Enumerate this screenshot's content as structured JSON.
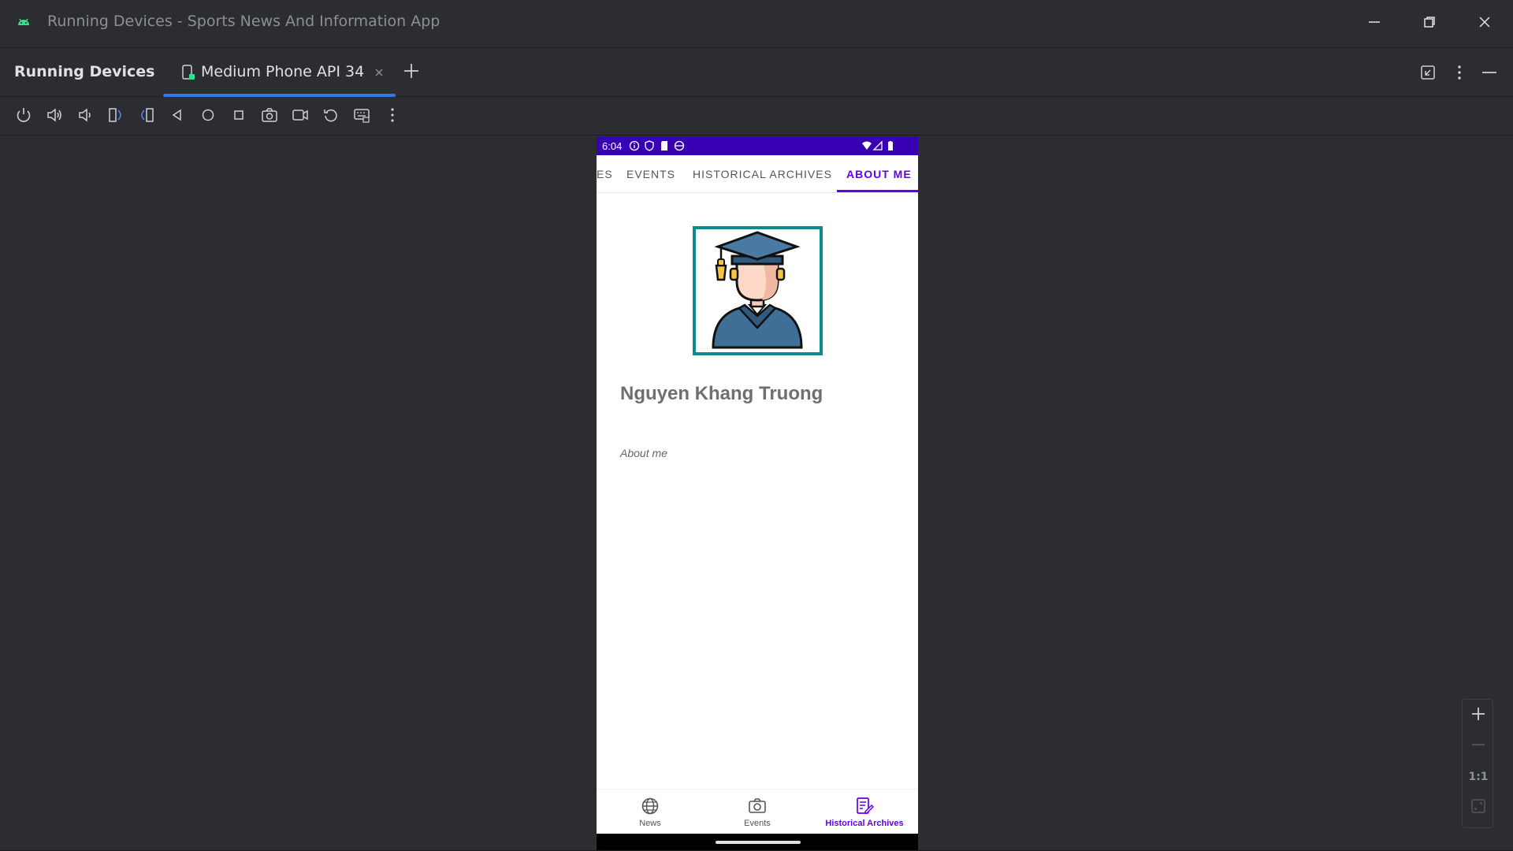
{
  "window": {
    "title": "Running Devices - Sports News And Information App",
    "controls": [
      "minimize-icon",
      "restore-icon",
      "close-icon"
    ]
  },
  "tool_window": {
    "title": "Running Devices",
    "tab_label": "Medium Phone API 34",
    "header_icons": [
      "restore-layout-icon",
      "more-vertical-icon",
      "hide-icon"
    ]
  },
  "toolbar": {
    "buttons": [
      "power-icon",
      "volume-up-icon",
      "volume-down-icon",
      "rotate-left-icon",
      "rotate-right-icon",
      "back-icon",
      "home-icon",
      "overview-icon",
      "screenshot-icon",
      "screen-record-icon",
      "reset-icon",
      "keyboard-icon",
      "more-vertical-icon"
    ]
  },
  "phone": {
    "status": {
      "time": "6:04",
      "accent": "#3700b3"
    },
    "top_nav": {
      "items": [
        "ES",
        "EVENTS",
        "HISTORICAL ARCHIVES",
        "ABOUT ME"
      ],
      "active": "ABOUT ME",
      "accent": "#6200ee"
    },
    "profile": {
      "name": "Nguyen Khang Truong",
      "about": "About me",
      "avatar_icon": "graduate-avatar-icon",
      "frame_color": "#0b8a8f"
    },
    "bottom_nav": {
      "items": [
        {
          "label": "News",
          "icon": "globe-icon"
        },
        {
          "label": "Events",
          "icon": "camera-icon"
        },
        {
          "label": "Historical Archives",
          "icon": "archive-edit-icon"
        }
      ],
      "active": "Historical Archives"
    }
  },
  "zoom_panel": {
    "zoom_in": "+",
    "zoom_out": "—",
    "actual_size": "1:1"
  }
}
